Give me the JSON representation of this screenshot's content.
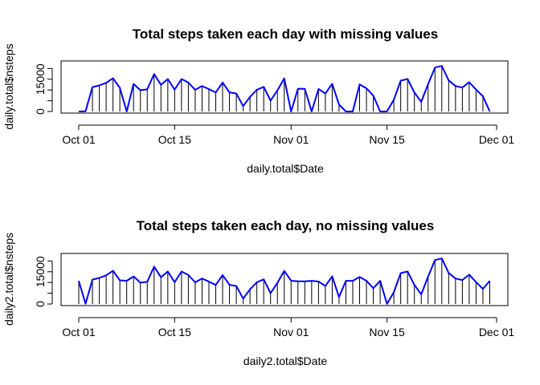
{
  "chart_data": [
    {
      "type": "line",
      "title": "Total steps taken each day with missing values",
      "xlabel": "daily.total$Date",
      "ylabel": "daily.total$nsteps",
      "x_ticks": [
        "Oct 01",
        "Oct 15",
        "Nov 01",
        "Nov 15",
        "Dec 01"
      ],
      "y_ticks": [
        "0",
        "15000"
      ],
      "ylim": [
        0,
        22000
      ],
      "line_color": "#0000ff",
      "x": [
        "2012-10-01",
        "2012-10-02",
        "2012-10-03",
        "2012-10-04",
        "2012-10-05",
        "2012-10-06",
        "2012-10-07",
        "2012-10-08",
        "2012-10-09",
        "2012-10-10",
        "2012-10-11",
        "2012-10-12",
        "2012-10-13",
        "2012-10-14",
        "2012-10-15",
        "2012-10-16",
        "2012-10-17",
        "2012-10-18",
        "2012-10-19",
        "2012-10-20",
        "2012-10-21",
        "2012-10-22",
        "2012-10-23",
        "2012-10-24",
        "2012-10-25",
        "2012-10-26",
        "2012-10-27",
        "2012-10-28",
        "2012-10-29",
        "2012-10-30",
        "2012-10-31",
        "2012-11-01",
        "2012-11-02",
        "2012-11-03",
        "2012-11-04",
        "2012-11-05",
        "2012-11-06",
        "2012-11-07",
        "2012-11-08",
        "2012-11-09",
        "2012-11-10",
        "2012-11-11",
        "2012-11-12",
        "2012-11-13",
        "2012-11-14",
        "2012-11-15",
        "2012-11-16",
        "2012-11-17",
        "2012-11-18",
        "2012-11-19",
        "2012-11-20",
        "2012-11-21",
        "2012-11-22",
        "2012-11-23",
        "2012-11-24",
        "2012-11-25",
        "2012-11-26",
        "2012-11-27",
        "2012-11-28",
        "2012-11-29",
        "2012-11-30"
      ],
      "values": [
        0,
        126,
        11352,
        12116,
        13294,
        15420,
        11015,
        0,
        12811,
        9900,
        10304,
        17382,
        12426,
        15098,
        10139,
        15084,
        13452,
        10056,
        11829,
        10395,
        8821,
        13460,
        8918,
        8355,
        2492,
        6778,
        10119,
        11458,
        5018,
        9819,
        15414,
        0,
        10600,
        10571,
        0,
        10439,
        8334,
        12883,
        3219,
        0,
        0,
        12608,
        10765,
        7336,
        0,
        41,
        5441,
        14339,
        15110,
        8841,
        4472,
        12787,
        20427,
        21194,
        14478,
        11834,
        11162,
        13646,
        10183,
        7047,
        0
      ]
    },
    {
      "type": "line",
      "title": "Total steps taken each day, no missing values",
      "xlabel": "daily2.total$Date",
      "ylabel": "daily2.total$nsteps",
      "x_ticks": [
        "Oct 01",
        "Oct 15",
        "Nov 01",
        "Nov 15",
        "Dec 01"
      ],
      "y_ticks": [
        "0",
        "15000"
      ],
      "ylim": [
        0,
        22000
      ],
      "line_color": "#0000ff",
      "x": [
        "2012-10-01",
        "2012-10-02",
        "2012-10-03",
        "2012-10-04",
        "2012-10-05",
        "2012-10-06",
        "2012-10-07",
        "2012-10-08",
        "2012-10-09",
        "2012-10-10",
        "2012-10-11",
        "2012-10-12",
        "2012-10-13",
        "2012-10-14",
        "2012-10-15",
        "2012-10-16",
        "2012-10-17",
        "2012-10-18",
        "2012-10-19",
        "2012-10-20",
        "2012-10-21",
        "2012-10-22",
        "2012-10-23",
        "2012-10-24",
        "2012-10-25",
        "2012-10-26",
        "2012-10-27",
        "2012-10-28",
        "2012-10-29",
        "2012-10-30",
        "2012-10-31",
        "2012-11-01",
        "2012-11-02",
        "2012-11-03",
        "2012-11-04",
        "2012-11-05",
        "2012-11-06",
        "2012-11-07",
        "2012-11-08",
        "2012-11-09",
        "2012-11-10",
        "2012-11-11",
        "2012-11-12",
        "2012-11-13",
        "2012-11-14",
        "2012-11-15",
        "2012-11-16",
        "2012-11-17",
        "2012-11-18",
        "2012-11-19",
        "2012-11-20",
        "2012-11-21",
        "2012-11-22",
        "2012-11-23",
        "2012-11-24",
        "2012-11-25",
        "2012-11-26",
        "2012-11-27",
        "2012-11-28",
        "2012-11-29",
        "2012-11-30"
      ],
      "values": [
        10766,
        126,
        11352,
        12116,
        13294,
        15420,
        11015,
        10766,
        12811,
        9900,
        10304,
        17382,
        12426,
        15098,
        10139,
        15084,
        13452,
        10056,
        11829,
        10395,
        8821,
        13460,
        8918,
        8355,
        2492,
        6778,
        10119,
        11458,
        5018,
        9819,
        15414,
        10766,
        10600,
        10571,
        10766,
        10439,
        8334,
        12883,
        3219,
        10766,
        10766,
        12608,
        10765,
        7336,
        10766,
        41,
        5441,
        14339,
        15110,
        8841,
        4472,
        12787,
        20427,
        21194,
        14478,
        11834,
        11162,
        13646,
        10183,
        7047,
        10766
      ]
    }
  ]
}
